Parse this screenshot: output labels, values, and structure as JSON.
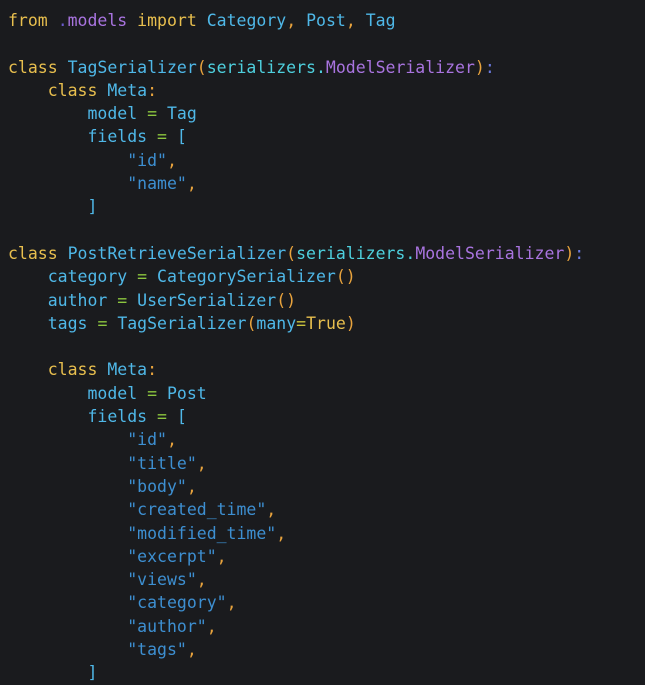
{
  "editor": {
    "language": "python",
    "background": "#1a1b1e",
    "font_size_px": 16.5,
    "line_height_px": 23.3,
    "palette": {
      "keyword": "#e8bf4e",
      "module": "#a974e0",
      "identifier": "#4fb8e8",
      "package": "#4ed0de",
      "punctuation": "#e8a33d",
      "colon": "#6a7ae0",
      "operator_assign": "#8cc63f",
      "operator_kwarg": "#c9c33d",
      "string": "#3d8fd1",
      "bracket": "#4fb8e8",
      "boolean": "#e8bf4e"
    }
  },
  "code": {
    "lines": [
      {
        "n": 1,
        "indent": 0,
        "tokens": [
          {
            "t": "from",
            "c": "kw"
          },
          {
            "t": " ",
            "c": "plain"
          },
          {
            "t": ".",
            "c": "dot-mod"
          },
          {
            "t": "models",
            "c": "mod"
          },
          {
            "t": " ",
            "c": "plain"
          },
          {
            "t": "import",
            "c": "kw"
          },
          {
            "t": " ",
            "c": "plain"
          },
          {
            "t": "Category",
            "c": "name"
          },
          {
            "t": ",",
            "c": "punct"
          },
          {
            "t": " ",
            "c": "plain"
          },
          {
            "t": "Post",
            "c": "name"
          },
          {
            "t": ",",
            "c": "punct"
          },
          {
            "t": " ",
            "c": "plain"
          },
          {
            "t": "Tag",
            "c": "name"
          }
        ]
      },
      {
        "n": 2,
        "indent": 0,
        "tokens": []
      },
      {
        "n": 3,
        "indent": 0,
        "tokens": [
          {
            "t": "class",
            "c": "kw"
          },
          {
            "t": " ",
            "c": "plain"
          },
          {
            "t": "TagSerializer",
            "c": "cls"
          },
          {
            "t": "(",
            "c": "punct"
          },
          {
            "t": "serializers",
            "c": "pkg"
          },
          {
            "t": ".",
            "c": "pkg"
          },
          {
            "t": "ModelSerializer",
            "c": "mod"
          },
          {
            "t": ")",
            "c": "punct"
          },
          {
            "t": ":",
            "c": "colon"
          }
        ]
      },
      {
        "n": 4,
        "indent": 1,
        "tokens": [
          {
            "t": "class",
            "c": "kw"
          },
          {
            "t": " ",
            "c": "plain"
          },
          {
            "t": "Meta",
            "c": "cls"
          },
          {
            "t": ":",
            "c": "punct"
          }
        ]
      },
      {
        "n": 5,
        "indent": 2,
        "tokens": [
          {
            "t": "model",
            "c": "name"
          },
          {
            "t": " ",
            "c": "plain"
          },
          {
            "t": "=",
            "c": "op"
          },
          {
            "t": " ",
            "c": "plain"
          },
          {
            "t": "Tag",
            "c": "name"
          }
        ]
      },
      {
        "n": 6,
        "indent": 2,
        "tokens": [
          {
            "t": "fields",
            "c": "name"
          },
          {
            "t": " ",
            "c": "plain"
          },
          {
            "t": "=",
            "c": "op"
          },
          {
            "t": " ",
            "c": "plain"
          },
          {
            "t": "[",
            "c": "brk"
          }
        ]
      },
      {
        "n": 7,
        "indent": 3,
        "tokens": [
          {
            "t": "\"id\"",
            "c": "str"
          },
          {
            "t": ",",
            "c": "punct"
          }
        ]
      },
      {
        "n": 8,
        "indent": 3,
        "tokens": [
          {
            "t": "\"name\"",
            "c": "str"
          },
          {
            "t": ",",
            "c": "punct"
          }
        ]
      },
      {
        "n": 9,
        "indent": 2,
        "tokens": [
          {
            "t": "]",
            "c": "brk"
          }
        ]
      },
      {
        "n": 10,
        "indent": 0,
        "tokens": []
      },
      {
        "n": 11,
        "indent": 0,
        "tokens": [
          {
            "t": "class",
            "c": "kw"
          },
          {
            "t": " ",
            "c": "plain"
          },
          {
            "t": "PostRetrieveSerializer",
            "c": "cls"
          },
          {
            "t": "(",
            "c": "punct"
          },
          {
            "t": "serializers",
            "c": "pkg"
          },
          {
            "t": ".",
            "c": "pkg"
          },
          {
            "t": "ModelSerializer",
            "c": "mod"
          },
          {
            "t": ")",
            "c": "punct"
          },
          {
            "t": ":",
            "c": "colon"
          }
        ]
      },
      {
        "n": 12,
        "indent": 1,
        "tokens": [
          {
            "t": "category",
            "c": "name"
          },
          {
            "t": " ",
            "c": "plain"
          },
          {
            "t": "=",
            "c": "op"
          },
          {
            "t": " ",
            "c": "plain"
          },
          {
            "t": "CategorySerializer",
            "c": "name"
          },
          {
            "t": "()",
            "c": "punct"
          }
        ]
      },
      {
        "n": 13,
        "indent": 1,
        "tokens": [
          {
            "t": "author",
            "c": "name"
          },
          {
            "t": " ",
            "c": "plain"
          },
          {
            "t": "=",
            "c": "op"
          },
          {
            "t": " ",
            "c": "plain"
          },
          {
            "t": "UserSerializer",
            "c": "name"
          },
          {
            "t": "()",
            "c": "punct"
          }
        ]
      },
      {
        "n": 14,
        "indent": 1,
        "tokens": [
          {
            "t": "tags",
            "c": "name"
          },
          {
            "t": " ",
            "c": "plain"
          },
          {
            "t": "=",
            "c": "op"
          },
          {
            "t": " ",
            "c": "plain"
          },
          {
            "t": "TagSerializer",
            "c": "name"
          },
          {
            "t": "(",
            "c": "punct"
          },
          {
            "t": "many",
            "c": "name"
          },
          {
            "t": "=",
            "c": "opk"
          },
          {
            "t": "True",
            "c": "bool"
          },
          {
            "t": ")",
            "c": "punct"
          }
        ]
      },
      {
        "n": 15,
        "indent": 0,
        "tokens": []
      },
      {
        "n": 16,
        "indent": 1,
        "tokens": [
          {
            "t": "class",
            "c": "kw"
          },
          {
            "t": " ",
            "c": "plain"
          },
          {
            "t": "Meta",
            "c": "cls"
          },
          {
            "t": ":",
            "c": "punct"
          }
        ]
      },
      {
        "n": 17,
        "indent": 2,
        "tokens": [
          {
            "t": "model",
            "c": "name"
          },
          {
            "t": " ",
            "c": "plain"
          },
          {
            "t": "=",
            "c": "op"
          },
          {
            "t": " ",
            "c": "plain"
          },
          {
            "t": "Post",
            "c": "name"
          }
        ]
      },
      {
        "n": 18,
        "indent": 2,
        "tokens": [
          {
            "t": "fields",
            "c": "name"
          },
          {
            "t": " ",
            "c": "plain"
          },
          {
            "t": "=",
            "c": "op"
          },
          {
            "t": " ",
            "c": "plain"
          },
          {
            "t": "[",
            "c": "brk"
          }
        ]
      },
      {
        "n": 19,
        "indent": 3,
        "tokens": [
          {
            "t": "\"id\"",
            "c": "str"
          },
          {
            "t": ",",
            "c": "punct"
          }
        ]
      },
      {
        "n": 20,
        "indent": 3,
        "tokens": [
          {
            "t": "\"title\"",
            "c": "str"
          },
          {
            "t": ",",
            "c": "punct"
          }
        ]
      },
      {
        "n": 21,
        "indent": 3,
        "tokens": [
          {
            "t": "\"body\"",
            "c": "str"
          },
          {
            "t": ",",
            "c": "punct"
          }
        ]
      },
      {
        "n": 22,
        "indent": 3,
        "tokens": [
          {
            "t": "\"created_time\"",
            "c": "str"
          },
          {
            "t": ",",
            "c": "punct"
          }
        ]
      },
      {
        "n": 23,
        "indent": 3,
        "tokens": [
          {
            "t": "\"modified_time\"",
            "c": "str"
          },
          {
            "t": ",",
            "c": "punct"
          }
        ]
      },
      {
        "n": 24,
        "indent": 3,
        "tokens": [
          {
            "t": "\"excerpt\"",
            "c": "str"
          },
          {
            "t": ",",
            "c": "punct"
          }
        ]
      },
      {
        "n": 25,
        "indent": 3,
        "tokens": [
          {
            "t": "\"views\"",
            "c": "str"
          },
          {
            "t": ",",
            "c": "punct"
          }
        ]
      },
      {
        "n": 26,
        "indent": 3,
        "tokens": [
          {
            "t": "\"category\"",
            "c": "str"
          },
          {
            "t": ",",
            "c": "punct"
          }
        ]
      },
      {
        "n": 27,
        "indent": 3,
        "tokens": [
          {
            "t": "\"author\"",
            "c": "str"
          },
          {
            "t": ",",
            "c": "punct"
          }
        ]
      },
      {
        "n": 28,
        "indent": 3,
        "tokens": [
          {
            "t": "\"tags\"",
            "c": "str"
          },
          {
            "t": ",",
            "c": "punct"
          }
        ]
      },
      {
        "n": 29,
        "indent": 2,
        "tokens": [
          {
            "t": "]",
            "c": "brk"
          }
        ]
      }
    ]
  }
}
